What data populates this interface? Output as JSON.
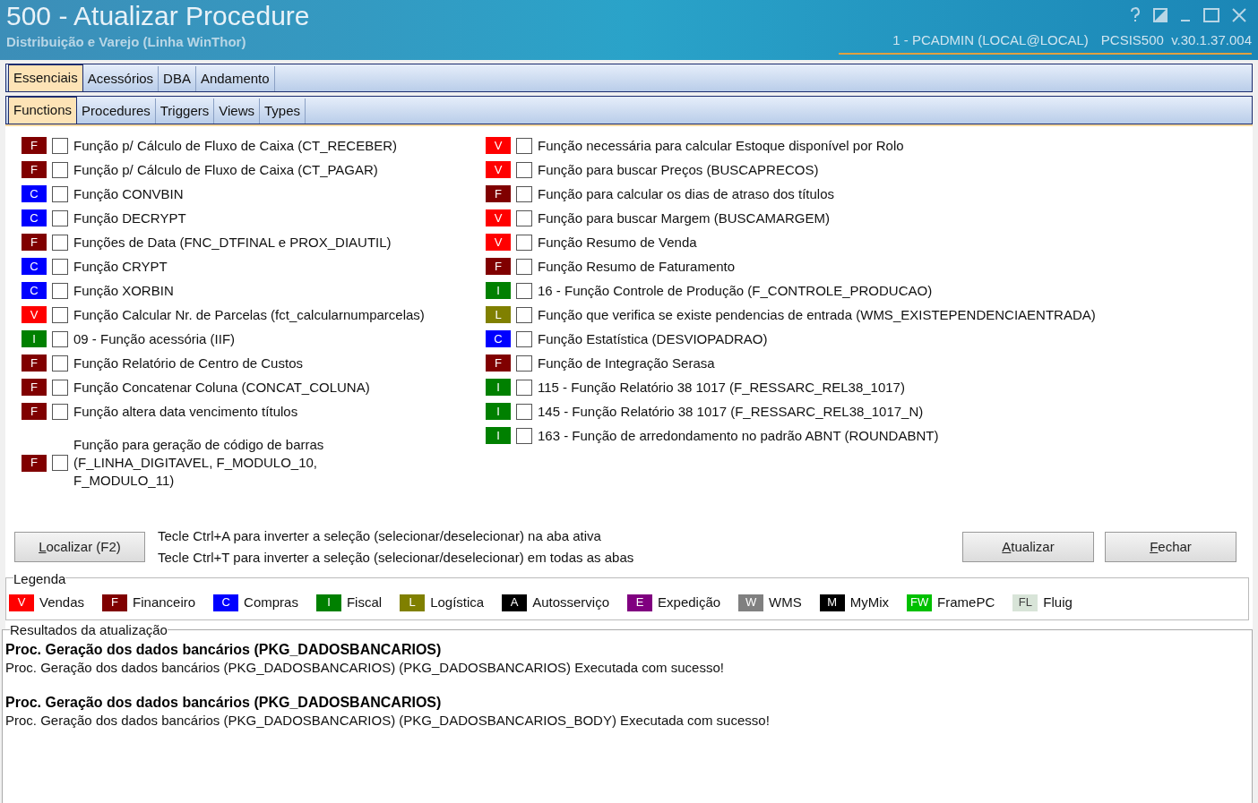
{
  "window": {
    "title": "500 - Atualizar Procedure",
    "subtitle": "Distribuição e Varejo (Linha WinThor)",
    "session": "1 - PCADMIN (LOCAL@LOCAL)",
    "version": "PCSIS500  v.30.1.37.004"
  },
  "tabs": [
    {
      "label": "Essenciais",
      "selected": true
    },
    {
      "label": "Acessórios",
      "selected": false
    },
    {
      "label": "DBA",
      "selected": false
    },
    {
      "label": "Andamento",
      "selected": false
    }
  ],
  "subtabs": [
    {
      "label": "Functions",
      "selected": true
    },
    {
      "label": "Procedures",
      "selected": false
    },
    {
      "label": "Triggers",
      "selected": false
    },
    {
      "label": "Views",
      "selected": false
    },
    {
      "label": "Types",
      "selected": false
    }
  ],
  "left_items": [
    {
      "badge": "F",
      "color": "#800000",
      "label": "Função p/ Cálculo de Fluxo de Caixa (CT_RECEBER)",
      "checked": false
    },
    {
      "badge": "F",
      "color": "#800000",
      "label": "Função p/ Cálculo de Fluxo de Caixa (CT_PAGAR)",
      "checked": false
    },
    {
      "badge": "C",
      "color": "#0000ff",
      "label": "Função CONVBIN",
      "checked": false
    },
    {
      "badge": "C",
      "color": "#0000ff",
      "label": "Função DECRYPT",
      "checked": false
    },
    {
      "badge": "F",
      "color": "#800000",
      "label": "Funções de Data (FNC_DTFINAL e PROX_DIAUTIL)",
      "checked": false
    },
    {
      "badge": "C",
      "color": "#0000ff",
      "label": "Função CRYPT",
      "checked": false
    },
    {
      "badge": "C",
      "color": "#0000ff",
      "label": "Função XORBIN",
      "checked": false
    },
    {
      "badge": "V",
      "color": "#ff0000",
      "label": "Função Calcular Nr. de Parcelas (fct_calcularnumparcelas)",
      "checked": false
    },
    {
      "badge": "I",
      "color": "#008000",
      "label": "09 - Função acessória (IIF)",
      "checked": false
    },
    {
      "badge": "F",
      "color": "#800000",
      "label": "Função Relatório de Centro de Custos",
      "checked": false
    },
    {
      "badge": "F",
      "color": "#800000",
      "label": "Função Concatenar Coluna (CONCAT_COLUNA)",
      "checked": false
    },
    {
      "badge": "F",
      "color": "#800000",
      "label": "Função altera data vencimento títulos",
      "checked": false
    },
    {
      "badge": "F",
      "color": "#800000",
      "label": "Função para geração de código de barras (F_LINHA_DIGITAVEL, F_MODULO_10, F_MODULO_11)",
      "checked": false
    }
  ],
  "right_items": [
    {
      "badge": "V",
      "color": "#ff0000",
      "label": "Função necessária para calcular Estoque disponível por Rolo",
      "checked": false
    },
    {
      "badge": "V",
      "color": "#ff0000",
      "label": "Função para buscar Preços (BUSCAPRECOS)",
      "checked": false
    },
    {
      "badge": "F",
      "color": "#800000",
      "label": "Função para calcular os dias de atraso dos títulos",
      "checked": false
    },
    {
      "badge": "V",
      "color": "#ff0000",
      "label": "Função para buscar Margem (BUSCAMARGEM)",
      "checked": false
    },
    {
      "badge": "V",
      "color": "#ff0000",
      "label": "Função Resumo de Venda",
      "checked": false
    },
    {
      "badge": "F",
      "color": "#800000",
      "label": "Função Resumo de Faturamento",
      "checked": false
    },
    {
      "badge": "I",
      "color": "#008000",
      "label": "16 - Função Controle de Produção (F_CONTROLE_PRODUCAO)",
      "checked": false
    },
    {
      "badge": "L",
      "color": "#808000",
      "label": "Função que verifica se existe pendencias de entrada (WMS_EXISTEPENDENCIAENTRADA)",
      "checked": false
    },
    {
      "badge": "C",
      "color": "#0000ff",
      "label": "Função Estatística (DESVIOPADRAO)",
      "checked": false
    },
    {
      "badge": "F",
      "color": "#800000",
      "label": "Função de Integração Serasa",
      "checked": false
    },
    {
      "badge": "I",
      "color": "#008000",
      "label": "115 - Função Relatório 38 1017 (F_RESSARC_REL38_1017)",
      "checked": false
    },
    {
      "badge": "I",
      "color": "#008000",
      "label": "145 - Função Relatório 38 1017 (F_RESSARC_REL38_1017_N)",
      "checked": false
    },
    {
      "badge": "I",
      "color": "#008000",
      "label": "163 - Função de arredondamento no padrão ABNT (ROUNDABNT)",
      "checked": false
    }
  ],
  "find_button": {
    "accel": "L",
    "rest": "ocalizar (F2)"
  },
  "hints": [
    "Tecle Ctrl+A para inverter a seleção (selecionar/deselecionar) na aba ativa",
    "Tecle Ctrl+T para inverter a seleção (selecionar/deselecionar) em todas as abas"
  ],
  "action_buttons": [
    {
      "accel": "A",
      "rest": "tualizar"
    },
    {
      "accel": "F",
      "rest": "echar"
    }
  ],
  "legend": {
    "title": "Legenda",
    "items": [
      {
        "badge": "V",
        "color": "#ff0000",
        "label": "Vendas"
      },
      {
        "badge": "F",
        "color": "#800000",
        "label": "Financeiro"
      },
      {
        "badge": "C",
        "color": "#0000ff",
        "label": "Compras"
      },
      {
        "badge": "I",
        "color": "#008000",
        "label": "Fiscal"
      },
      {
        "badge": "L",
        "color": "#808000",
        "label": "Logística"
      },
      {
        "badge": "A",
        "color": "#000000",
        "label": "Autosserviço"
      },
      {
        "badge": "E",
        "color": "#800080",
        "label": "Expedição"
      },
      {
        "badge": "W",
        "color": "#808080",
        "label": "WMS"
      },
      {
        "badge": "M",
        "color": "#000000",
        "label": "MyMix"
      },
      {
        "badge": "FW",
        "color": "#00c000",
        "label": "FramePC"
      },
      {
        "badge": "FL",
        "color": "#d8e4d8",
        "label": "Fluig"
      }
    ]
  },
  "results": {
    "title": "Resultados da atualização",
    "entries": [
      {
        "heading": "Proc. Geração dos dados bancários (PKG_DADOSBANCARIOS)",
        "message": "Proc. Geração dos dados bancários (PKG_DADOSBANCARIOS) (PKG_DADOSBANCARIOS) Executada com sucesso!"
      },
      {
        "heading": "Proc. Geração dos dados bancários (PKG_DADOSBANCARIOS)",
        "message": "Proc. Geração dos dados bancários (PKG_DADOSBANCARIOS) (PKG_DADOSBANCARIOS_BODY) Executada com sucesso!"
      }
    ]
  }
}
